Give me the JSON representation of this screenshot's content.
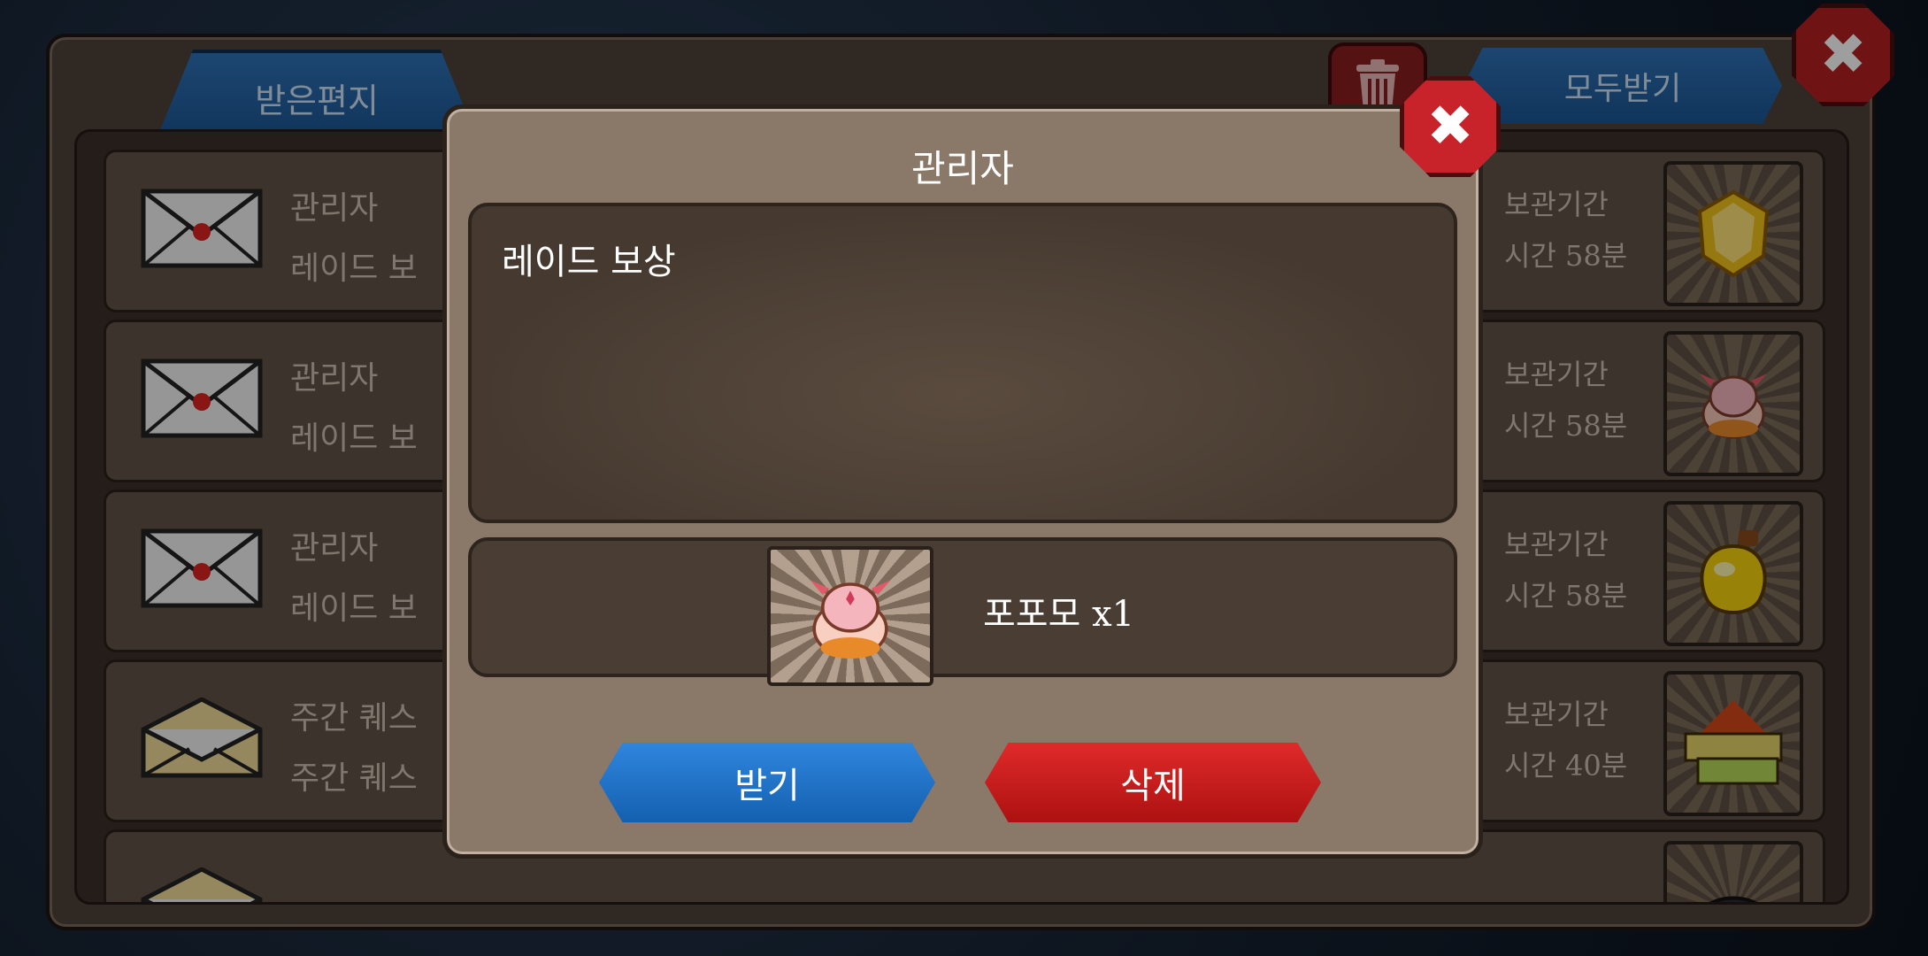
{
  "mailbox": {
    "tab_label": "받은편지",
    "receive_all_label": "모두받기",
    "close_glyph": "✖",
    "trash_icon": "trash-icon",
    "rows": [
      {
        "sender": "관리자",
        "subject": "레이드 보",
        "expire_label": "보관기간",
        "expire_time": "시간 58분",
        "envelope": "sealed",
        "item_icon": "gold-gem-icon"
      },
      {
        "sender": "관리자",
        "subject": "레이드 보",
        "expire_label": "보관기간",
        "expire_time": "시간 58분",
        "envelope": "sealed",
        "item_icon": "popomo-pet-icon"
      },
      {
        "sender": "관리자",
        "subject": "레이드 보",
        "expire_label": "보관기간",
        "expire_time": "시간 58분",
        "envelope": "sealed",
        "item_icon": "potion-icon"
      },
      {
        "sender": "주간 퀘스",
        "subject": "주간 퀘스",
        "expire_label": "보관기간",
        "expire_time": "시간 40분",
        "envelope": "opened",
        "item_icon": "level-up-icon"
      }
    ]
  },
  "dialog": {
    "title": "관리자",
    "message": "레이드 보상",
    "reward_name": "포포모 x1",
    "reward_icon": "popomo-pet-icon",
    "receive_label": "받기",
    "delete_label": "삭제",
    "close_glyph": "✖"
  },
  "colors": {
    "blue_button": "#1b6fc4",
    "red_button": "#c21818",
    "panel_brown": "#8a7868"
  }
}
